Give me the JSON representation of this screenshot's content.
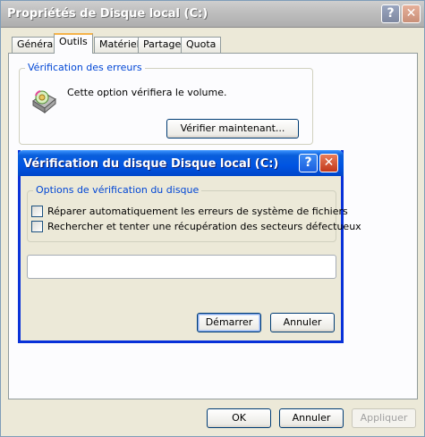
{
  "window": {
    "title": "Propriétés de Disque local (C:)",
    "help_glyph": "?",
    "close_glyph": "✕"
  },
  "tabs": [
    {
      "label": "Général"
    },
    {
      "label": "Outils"
    },
    {
      "label": "Matériel"
    },
    {
      "label": "Partage"
    },
    {
      "label": "Quota"
    }
  ],
  "error_check": {
    "legend": "Vérification des erreurs",
    "description": "Cette option vérifiera le volume.",
    "button": "Vérifier maintenant..."
  },
  "dialog": {
    "title": "Vérification du disque Disque local (C:)",
    "help_glyph": "?",
    "close_glyph": "✕",
    "options_legend": "Options de vérification du disque",
    "option_fix": "Réparer automatiquement les erreurs de système de fichiers",
    "option_scan": "Rechercher et tenter une récupération des secteurs défectueux",
    "start_button": "Démarrer",
    "cancel_button": "Annuler",
    "progress": 0
  },
  "footer": {
    "ok": "OK",
    "cancel": "Annuler",
    "apply": "Appliquer"
  },
  "colors": {
    "dialog_title": "#0054e3",
    "legend": "#0046d5",
    "face": "#ece9d8"
  }
}
